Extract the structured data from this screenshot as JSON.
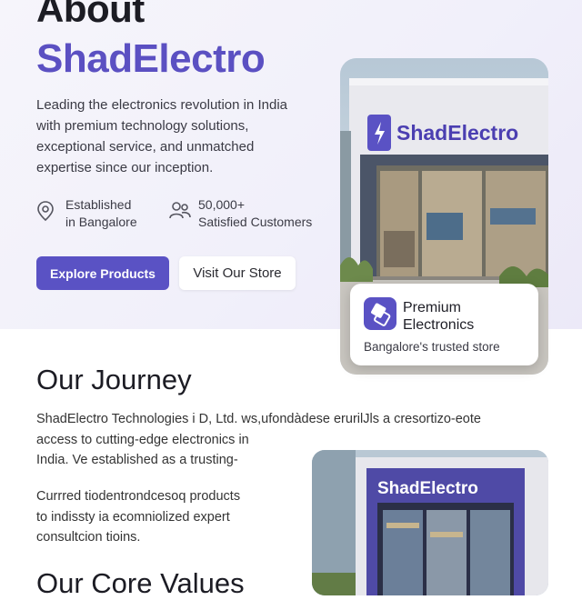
{
  "hero": {
    "title_line1": "About",
    "title_line2": "ShadElectro",
    "lead": "Leading the electronics revolution in India with premium technology solutions, exceptional service, and unmatched expertise since our inception.",
    "stats": [
      {
        "line1": "Established",
        "line2": "in Bangalore",
        "icon": "map-pin-icon"
      },
      {
        "line1": "50,000+",
        "line2": "Satisfied Customers",
        "icon": "users-icon"
      }
    ],
    "primary_button": "Explore Products",
    "secondary_button": "Visit Our Store",
    "store_sign": "ShadElectro",
    "card": {
      "title_line1": "Premium",
      "title_line2": "Electronics",
      "subtitle": "Bangalore's trusted store",
      "icon": "chip-icon"
    }
  },
  "journey": {
    "title": "Our Journey",
    "paragraph1_line1": "ShadElectro Technologies i D, Ltd. ws,ufondàdese erurilJls a cresortizo-eote",
    "paragraph1_line2": "access to cutting-edge electronics in",
    "paragraph1_line3": "India. Ve established as a trusting-",
    "paragraph2_line1": "Currred tiodentrondcesoq products",
    "paragraph2_line2": "to indissty ia ecomniolized expert",
    "paragraph2_line3": "consultcion tioins.",
    "store_sign": "ShadElectro"
  },
  "values": {
    "title": "Our Core Values"
  },
  "colors": {
    "accent": "#5a52c4",
    "brand_text": "#5b50c2",
    "hero_bg": "#f3f2fa"
  }
}
